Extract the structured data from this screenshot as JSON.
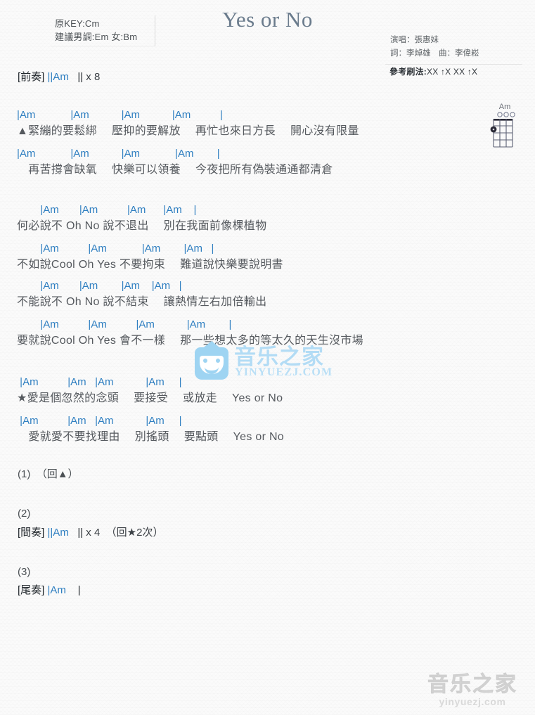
{
  "header": {
    "key_box": {
      "original_key": "原KEY:Cm",
      "suggested_key": "建議男調:Em 女:Bm"
    },
    "title": "Yes or No",
    "credits": {
      "singer": "演唱：張惠妹",
      "writers": "詞：李焯雄　曲：李偉崧"
    },
    "strum": {
      "label": "參考刷法:",
      "pattern": "XX ↑X XX ↑X"
    }
  },
  "chord_diagram": {
    "name": "Am",
    "open_strings": [
      2,
      3,
      4
    ],
    "dots": [
      {
        "string": 1,
        "fret": 2
      }
    ],
    "strings": 4,
    "frets": 4
  },
  "intro": {
    "label": "[前奏]",
    "bars": "||Am",
    "close": "||",
    "repeat": "x 8"
  },
  "blocks": [
    {
      "id": "verse-1",
      "lines": [
        {
          "chords": "|Am            |Am           |Am           |Am          |",
          "lyrics": "▲緊繃的要鬆綁　 壓抑的要解放　 再忙也來日方長　 開心沒有限量"
        },
        {
          "chords": "|Am            |Am           |Am            |Am        |",
          "lyrics": "　再苦撐會缺氧　 快樂可以領養　 今夜把所有偽裝通通都清倉"
        }
      ]
    },
    {
      "id": "verse-2",
      "lines": [
        {
          "chords": "        |Am       |Am          |Am      |Am    |",
          "lyrics": "何必說不 Oh No 說不退出　 別在我面前像棵植物"
        },
        {
          "chords": "        |Am          |Am            |Am        |Am   |",
          "lyrics": "不如說Cool Oh Yes 不要拘束　 難道說快樂要說明書"
        }
      ]
    },
    {
      "id": "verse-3",
      "lines": [
        {
          "chords": "        |Am       |Am        |Am    |Am   |",
          "lyrics": "不能說不 Oh No 說不結束　 讓熱情左右加倍輸出"
        },
        {
          "chords": "        |Am          |Am          |Am           |Am        |",
          "lyrics": "要就說Cool Oh Yes 會不一樣　 那一些想太多的等太久的天生沒市場"
        }
      ]
    },
    {
      "id": "chorus",
      "lines": [
        {
          "chords": " |Am          |Am   |Am           |Am     |",
          "lyrics": "★愛是個忽然的念頭　 要接受　 或放走　 Yes or No"
        },
        {
          "chords": " |Am          |Am   |Am           |Am     |",
          "lyrics": "　愛就愛不要找理由　 別搖頭　 要點頭　 Yes or No"
        }
      ]
    }
  ],
  "sections": [
    {
      "id": "section-1",
      "number": "(1)",
      "content": "（回▲）"
    },
    {
      "id": "section-2",
      "number": "(2)",
      "label": "[間奏]",
      "bars": "||Am",
      "close": "||",
      "repeat": "x 4",
      "note": "（回★2次）"
    },
    {
      "id": "section-3",
      "number": "(3)",
      "label": "[尾奏]",
      "bars": "|Am",
      "close": "|"
    }
  ],
  "watermarks": {
    "center": {
      "name": "音乐之家",
      "url": "YINYUEZJ.COM",
      "icon": "house-smile-logo"
    },
    "bottom": {
      "name": "音乐之家",
      "url": "yinyuezj.com"
    }
  },
  "colors": {
    "chord": "#2f7fc1",
    "lyric": "#55595e",
    "title": "#6a7b8c",
    "watermark_blue": "#b3dcf5",
    "watermark_gray": "#d6d6d6"
  }
}
